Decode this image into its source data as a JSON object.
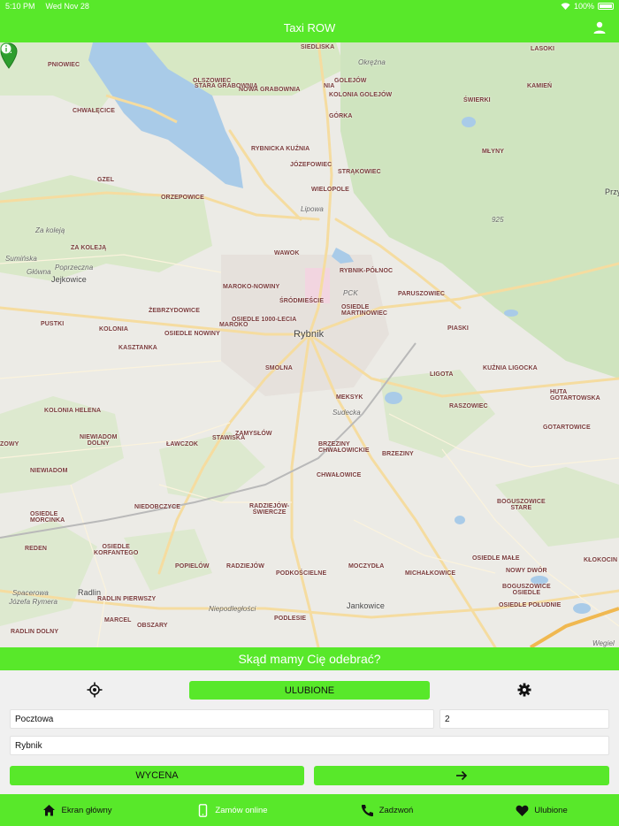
{
  "status_bar": {
    "time": "5:10 PM",
    "date": "Wed Nov 28",
    "battery": "100%"
  },
  "header": {
    "title": "Taxi ROW",
    "account_icon": "person-icon"
  },
  "map": {
    "labels": {
      "pniowiec": "PNIOWIEC",
      "olszowiec": "OLSZOWIEC",
      "stara_grabownia": "STARA GRABOWNIA",
      "nowa_grabownia": "NOWA GRABOWNIA",
      "siedliska": "SIEDLISKA",
      "okrzeja": "Okrężna",
      "niewiadom_top": "NIA",
      "golejow": "GOLEJÓW",
      "kolonia_golejow": "KOLONIA GOLEJÓW",
      "lasoki": "LASOKI",
      "kamien": "KAMIEŃ",
      "swierki": "ŚWIERKI",
      "chwalecice": "CHWAŁĘCICE",
      "gorka": "GÓRKA",
      "rybnicka_kuznia": "RYBNICKA KUŹNIA",
      "jozefowiec": "JÓZEFOWIEC",
      "strakowiec": "STRĄKOWIEC",
      "mlyny": "MŁYNY",
      "gzel": "GZEL",
      "wielopole": "WIELOPOLE",
      "orzepowice": "ORZEPOWICE",
      "przy": "Przy",
      "lipowa": "Lipowa",
      "road_925": "925",
      "za_koleja_road": "Za koleją",
      "za_koleja": "ZA KOLEJĄ",
      "wawok": "WAWOK",
      "suminska": "Sumińska",
      "glowna": "Główna",
      "poprzeczna": "Poprzeczna",
      "jejkowice": "Jejkowice",
      "rybnik_polnoc": "RYBNIK-PÓŁNOC",
      "maroko_nowiny": "MAROKO-NOWINY",
      "pck": "PCK",
      "paruszowiec": "PARUSZOWIEC",
      "srodmiescie": "ŚRÓDMIEŚCIE",
      "osiedle_martinowiec": "OSIEDLE\nMARTINOWIEC",
      "zebrzydowice": "ŻEBRZYDOWICE",
      "osiedle_1000": "OSIEDLE 1000-LECIA",
      "maroko": "MAROKO",
      "pustki": "PUSTKI",
      "kolonia": "KOLONIA",
      "osiedle_nowiny": "OSIEDLE NOWINY",
      "rybnik": "Rybnik",
      "piaski": "PIASKI",
      "kasztanka": "KASZTANKA",
      "smolna": "SMOLNA",
      "kuznia_ligocka": "KUŹNIA LIGOCKA",
      "ligota": "LIGOTA",
      "huta_gotartowska": "HUTA\nGOTARTOWSKA",
      "meksyk": "MEKSYK",
      "sudecka": "Sudecka",
      "raszowiec": "RASZOWIEC",
      "kolonia_helena": "KOLONIA HELENA",
      "gotartowice": "GOTARTOWICE",
      "stawiska": "STAWISKA",
      "zamyslow": "ZAMYSŁÓW",
      "niewiadom_dolny": "NIEWIADOM\nDOLNY",
      "lawczok": "ŁAWCZOK",
      "brzeziny_chwalowickie": "BRZEZINY\nCHWAŁOWICKIE",
      "brzeziny": "BRZEZINY",
      "zowy": "ZOWY",
      "niewiadom": "NIEWIADOM",
      "chwalowice": "CHWAŁOWICE",
      "boguszowice_stare": "BOGUSZOWICE\nSTARE",
      "niedobczyce": "NIEDOBCZYCE",
      "radziejow_swiercze": "RADZIEJÓW-\nŚWIERCZE",
      "osiedle_morcinka": "OSIEDLE\nMORCINKA",
      "reden": "REDEN",
      "osiedle_korfantego": "OSIEDLE\nKORFANTEGO",
      "osiedle_male": "OSIEDLE MAŁE",
      "klokocin": "KŁOKOCIN",
      "popielow": "POPIELÓW",
      "radziejow": "RADZIEJÓW",
      "moczydla": "MOCZYDŁA",
      "michalkowice": "MICHAŁKOWICE",
      "nowy_dwor": "NOWY DWÓR",
      "podkoscielne": "PODKOŚCIELNE",
      "boguszowice_osiedle": "BOGUSZOWICE\nOSIEDLE",
      "osiedle_poludnie": "OSIEDLE POŁUDNIE",
      "radlin": "Radlin",
      "radlin_pierwszy": "RADLIN PIERWSZY",
      "jankowice": "Jankowice",
      "niepodleglosci": "Niepodległości",
      "marcel": "MARCEL",
      "obszary": "OBSZARY",
      "podlesie": "PODLESIE",
      "radlin_dolny": "RADLIN DOLNY",
      "wegiel": "Wegiel",
      "spacerowa": "Spacerowa",
      "jozefa_rymera": "Józefa Rymera"
    }
  },
  "prompt": "Skąd mamy Cię odebrać?",
  "panel": {
    "locate_icon": "crosshair-icon",
    "favorites_label": "ULUBIONE",
    "settings_icon": "gear-icon",
    "street_value": "Pocztowa",
    "number_value": "2",
    "city_value": "Rybnik",
    "price_label": "WYCENA",
    "next_icon": "arrow-right-icon"
  },
  "tabs": [
    {
      "label": "Ekran główny",
      "icon": "home-icon"
    },
    {
      "label": "Zamów online",
      "icon": "phone-device-icon"
    },
    {
      "label": "Zadzwoń",
      "icon": "call-icon"
    },
    {
      "label": "Ulubione",
      "icon": "heart-icon"
    }
  ],
  "colors": {
    "accent": "#58e82a",
    "active_tab_text": "#ffffff"
  }
}
